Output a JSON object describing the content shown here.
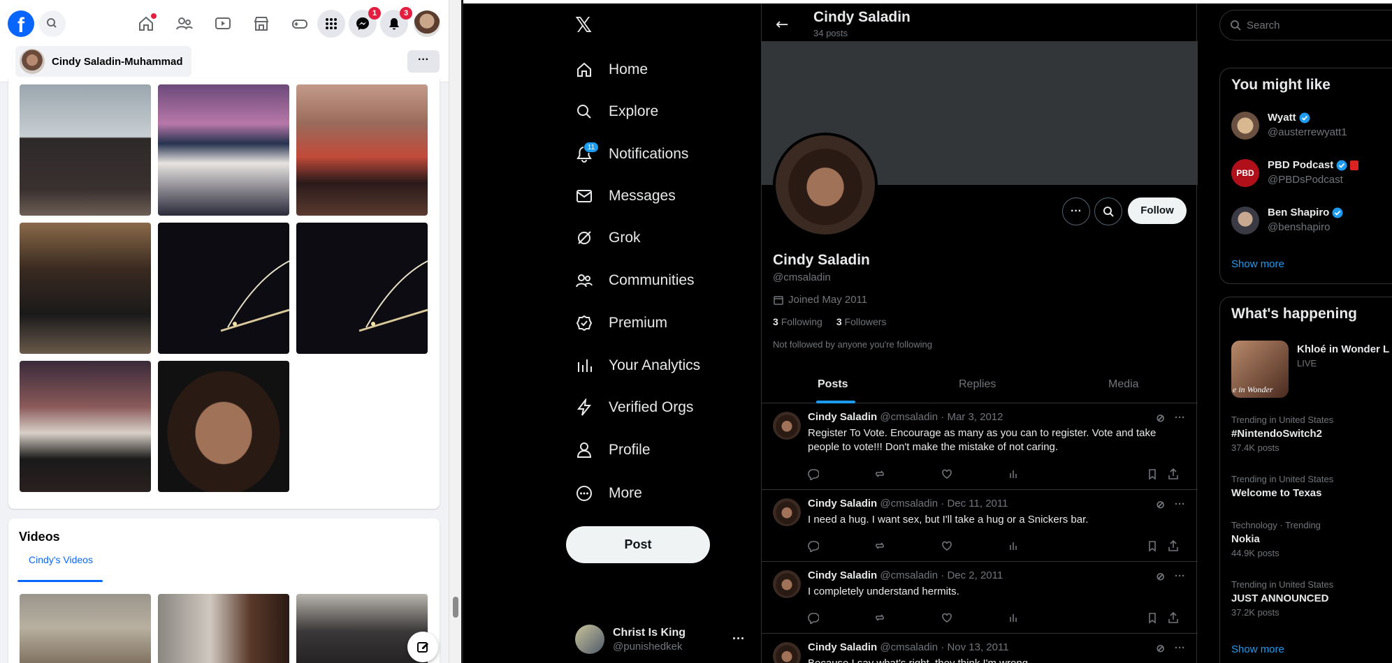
{
  "facebook": {
    "notifications": {
      "messenger_badge": "1",
      "bell_badge": "3"
    },
    "profile_name": "Cindy Saladin-Muhammad",
    "more_label": "···",
    "videos": {
      "title": "Videos",
      "tab": "Cindy's Videos"
    }
  },
  "x": {
    "logo": "𝕏",
    "nav": [
      {
        "label": "Home",
        "icon": "home-icon"
      },
      {
        "label": "Explore",
        "icon": "search-icon"
      },
      {
        "label": "Notifications",
        "icon": "bell-icon",
        "badge": "11"
      },
      {
        "label": "Messages",
        "icon": "mail-icon"
      },
      {
        "label": "Grok",
        "icon": "grok-icon"
      },
      {
        "label": "Communities",
        "icon": "communities-icon"
      },
      {
        "label": "Premium",
        "icon": "premium-icon"
      },
      {
        "label": "Your Analytics",
        "icon": "analytics-icon"
      },
      {
        "label": "Verified Orgs",
        "icon": "lightning-icon"
      },
      {
        "label": "Profile",
        "icon": "person-icon"
      },
      {
        "label": "More",
        "icon": "more-circle-icon"
      }
    ],
    "post_button": "Post",
    "account": {
      "name": "Christ Is King",
      "handle": "@punishedkek",
      "more": "···"
    },
    "header": {
      "name": "Cindy Saladin",
      "post_count": "34 posts",
      "back": "←"
    },
    "profile": {
      "name": "Cindy Saladin",
      "handle": "@cmsaladin",
      "joined": "Joined May 2011",
      "following_count": "3",
      "following_label": "Following",
      "followers_count": "3",
      "followers_label": "Followers",
      "note": "Not followed by anyone you're following",
      "follow_button": "Follow",
      "more_button": "···"
    },
    "tabs": [
      "Posts",
      "Replies",
      "Media"
    ],
    "tweets": [
      {
        "name": "Cindy Saladin",
        "meta": "@cmsaladin · Mar 3, 2012",
        "text": "Register To Vote. Encourage as many as you can to register. Vote and take people to vote!!! Don't make the mistake of not caring."
      },
      {
        "name": "Cindy Saladin",
        "meta": "@cmsaladin · Dec 11, 2011",
        "text": "I need a hug. I want sex, but I'll take a hug or a Snickers bar."
      },
      {
        "name": "Cindy Saladin",
        "meta": "@cmsaladin · Dec 2, 2011",
        "text": "I completely understand hermits."
      },
      {
        "name": "Cindy Saladin",
        "meta": "@cmsaladin · Nov 13, 2011",
        "text": "Because I say what's right, they think I'm wrong"
      }
    ],
    "search_placeholder": "Search",
    "you_might_like": {
      "title": "You might like",
      "users": [
        {
          "name": "Wyatt",
          "handle": "@austerrewyatt1"
        },
        {
          "name": "PBD Podcast",
          "handle": "@PBDsPodcast"
        },
        {
          "name": "Ben Shapiro",
          "handle": "@benshapiro"
        }
      ],
      "show_more": "Show more"
    },
    "whats_happening": {
      "title": "What's happening",
      "featured": {
        "name": "Khloé in Wonder L",
        "status": "LIVE",
        "thumb_text": "e in Wonder"
      },
      "trends": [
        {
          "context": "Trending in United States",
          "name": "#NintendoSwitch2",
          "count": "37.4K posts"
        },
        {
          "context": "Trending in United States",
          "name": "Welcome to Texas",
          "count": ""
        },
        {
          "context": "Technology · Trending",
          "name": "Nokia",
          "count": "44.9K posts"
        },
        {
          "context": "Trending in United States",
          "name": "JUST ANNOUNCED",
          "count": "37.2K posts"
        }
      ],
      "show_more": "Show more"
    },
    "colors": {
      "accent": "#1d9bf0",
      "background": "#000000",
      "border": "#2f3336"
    }
  }
}
